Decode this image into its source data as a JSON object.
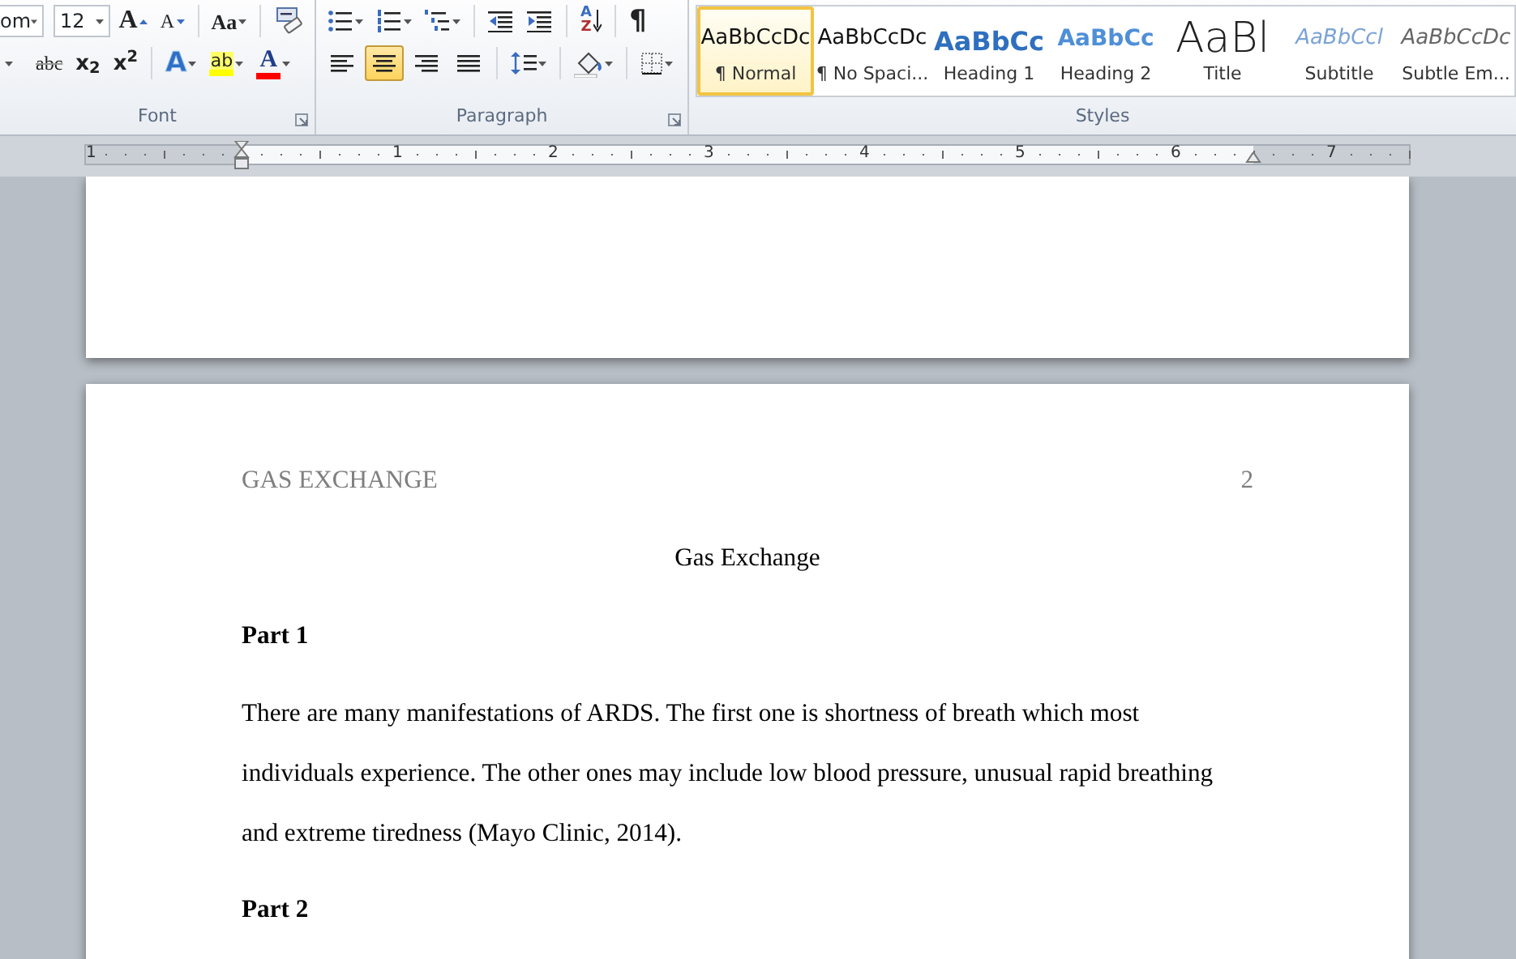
{
  "ribbon": {
    "font": {
      "label": "Font",
      "font_name": "om",
      "font_size": "12",
      "row1": [
        {
          "kind": "grow",
          "text": "A"
        },
        {
          "kind": "shrink",
          "text": "A"
        },
        {
          "kind": "case",
          "text": "Aa"
        },
        {
          "kind": "clear"
        }
      ],
      "row2": [
        {
          "kind": "dropdown"
        },
        {
          "kind": "strike",
          "text": "abc"
        },
        {
          "kind": "sub",
          "text": "x$_{2}$"
        },
        {
          "kind": "sup",
          "text": "x$^{2}$"
        },
        {
          "kind": "effects",
          "text": "A"
        },
        {
          "kind": "highlight",
          "text": "ab",
          "color": "#ffff00"
        },
        {
          "kind": "fontcolor",
          "text": "A",
          "color": "#ff0000"
        }
      ]
    },
    "paragraph": {
      "label": "Paragraph",
      "row1": [
        {
          "kind": "bullets"
        },
        {
          "kind": "numbering"
        },
        {
          "kind": "multilevel"
        },
        {
          "kind": "outdent"
        },
        {
          "kind": "indent"
        },
        {
          "kind": "sort",
          "top": "A",
          "bottom": "Z"
        },
        {
          "kind": "pilcrow",
          "text": "¶"
        }
      ],
      "alignment": [
        {
          "kind": "left",
          "selected": false
        },
        {
          "kind": "center",
          "selected": true
        },
        {
          "kind": "right",
          "selected": false
        },
        {
          "kind": "justify",
          "selected": false
        }
      ],
      "row2": [
        {
          "kind": "spacing"
        },
        {
          "kind": "shading"
        },
        {
          "kind": "borders"
        }
      ]
    },
    "styles": {
      "label": "Styles",
      "items": [
        {
          "preview": "AaBbCcDc",
          "name": "¶ Normal",
          "kind": "normal",
          "selected": true
        },
        {
          "preview": "AaBbCcDc",
          "name": "¶ No Spaci...",
          "kind": "normal",
          "selected": false
        },
        {
          "preview": "AaBbCc",
          "name": "Heading 1",
          "kind": "heading1",
          "selected": false
        },
        {
          "preview": "AaBbCc",
          "name": "Heading 2",
          "kind": "heading2",
          "selected": false
        },
        {
          "preview": "AaBl",
          "name": "Title",
          "kind": "title",
          "selected": false
        },
        {
          "preview": "AaBbCcl",
          "name": "Subtitle",
          "kind": "subtitle",
          "selected": false
        },
        {
          "preview": "AaBbCcDc",
          "name": "Subtle Em...",
          "kind": "subtle",
          "selected": false
        }
      ]
    }
  },
  "ruler": {
    "labels": [
      "1",
      "1",
      "2",
      "3",
      "4",
      "5",
      "6",
      "7"
    ]
  },
  "document": {
    "header": {
      "title": "GAS EXCHANGE",
      "page_number": "2"
    },
    "body": [
      {
        "kind": "title",
        "text": "Gas Exchange"
      },
      {
        "kind": "heading",
        "text": "Part 1"
      },
      {
        "kind": "paragraph",
        "text": "There are many manifestations of ARDS. The first one is shortness of breath which most individuals experience. The other ones may include low blood pressure, unusual rapid breathing and extreme tiredness (Mayo Clinic, 2014)."
      },
      {
        "kind": "heading",
        "text": "Part 2"
      }
    ]
  }
}
